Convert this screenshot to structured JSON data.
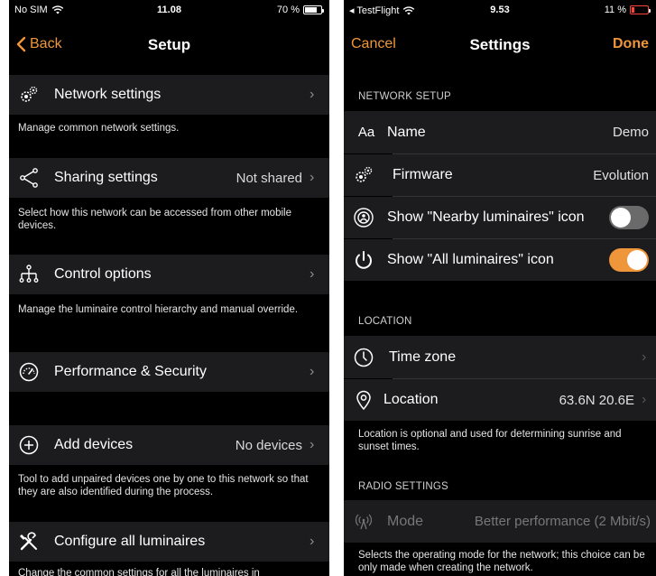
{
  "left": {
    "status": {
      "carrier": "No SIM",
      "time": "11.08",
      "battery": "70 %"
    },
    "nav": {
      "back": "Back",
      "title": "Setup"
    },
    "rows": [
      {
        "label": "Network settings",
        "value": "",
        "desc": "Manage common network settings.",
        "icon": "gears-icon"
      },
      {
        "label": "Sharing settings",
        "value": "Not shared",
        "desc": "Select how this network can be accessed from other mobile devices.",
        "icon": "share-icon"
      },
      {
        "label": "Control options",
        "value": "",
        "desc": "Manage the luminaire control hierarchy and manual override.",
        "icon": "hierarchy-icon"
      },
      {
        "label": "Performance & Security",
        "value": "",
        "desc": "",
        "icon": "gauge-icon"
      },
      {
        "label": "Add devices",
        "value": "No devices",
        "desc": "Tool to add unpaired devices one by one to this network so that they are also identified during the process.",
        "icon": "plus-circle-icon"
      },
      {
        "label": "Configure all luminaires",
        "value": "",
        "desc": "Change the common settings for all the luminaires in",
        "icon": "tools-icon"
      }
    ]
  },
  "right": {
    "status": {
      "carrier": "◂ TestFlight",
      "time": "9.53",
      "battery": "11 %"
    },
    "nav": {
      "cancel": "Cancel",
      "title": "Settings",
      "done": "Done"
    },
    "sections": {
      "network": "NETWORK SETUP",
      "location": "LOCATION",
      "radio": "RADIO SETTINGS"
    },
    "network_rows": [
      {
        "label": "Name",
        "value": "Demo",
        "icon": "text-aa-icon"
      },
      {
        "label": "Firmware",
        "value": "Evolution",
        "icon": "gears-icon"
      },
      {
        "label": "Show \"Nearby luminaires\" icon",
        "toggle": false,
        "icon": "nearby-icon"
      },
      {
        "label": "Show \"All luminaires\" icon",
        "toggle": true,
        "icon": "power-icon"
      }
    ],
    "icon_text_aa": "Aa",
    "location_rows": [
      {
        "label": "Time zone",
        "value": "",
        "icon": "clock-icon"
      },
      {
        "label": "Location",
        "value": "63.6N 20.6E",
        "icon": "location-pin-icon"
      }
    ],
    "location_desc": "Location is optional and used for determining sunrise and sunset times.",
    "radio_row": {
      "label": "Mode",
      "value": "Better performance (2 Mbit/s)"
    },
    "radio_desc": "Selects the operating mode for the network; this choice can be only made when creating the network."
  },
  "colors": {
    "accent": "#f0963a",
    "background": "#000000",
    "cell": "#1c1c1e"
  }
}
